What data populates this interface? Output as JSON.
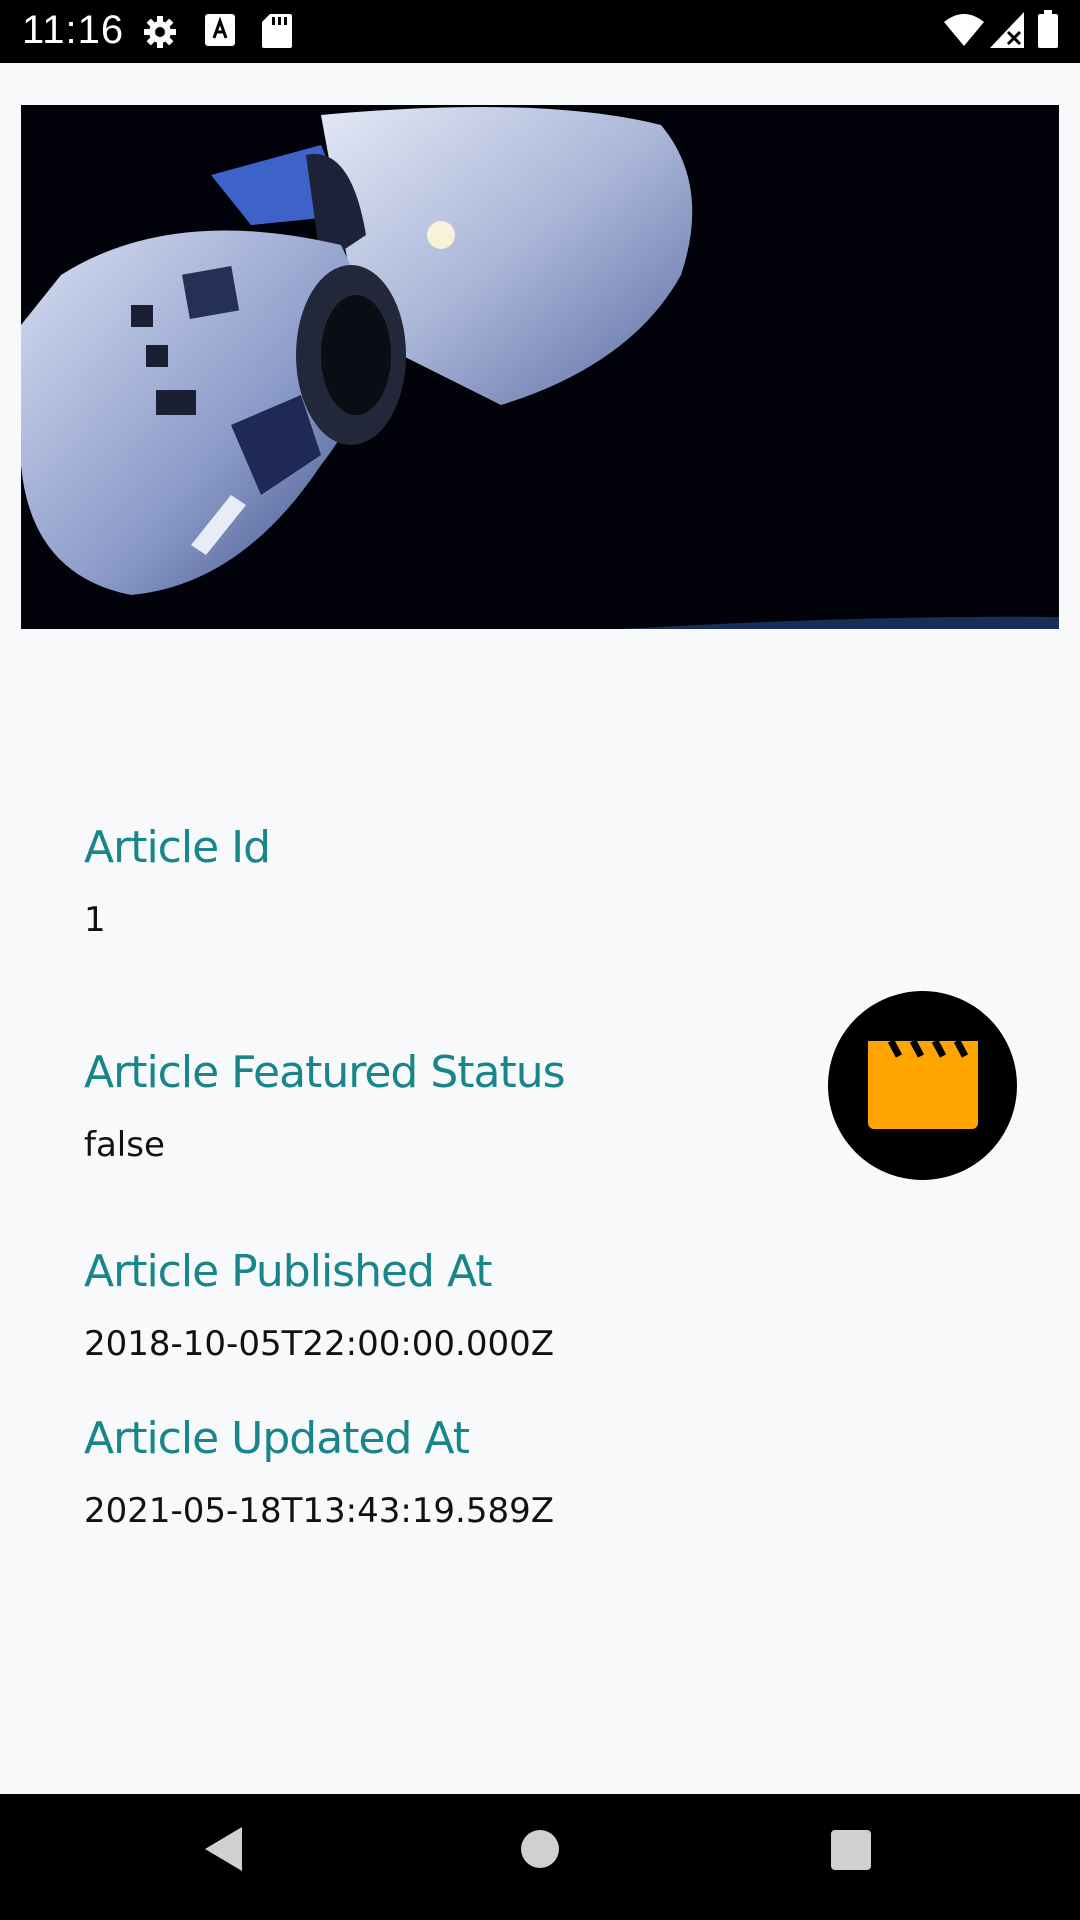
{
  "status_bar": {
    "time": "11:16",
    "icons": [
      "settings-icon",
      "font-download-icon",
      "sd-card-icon",
      "wifi-icon",
      "signal-no-data-icon",
      "battery-icon"
    ]
  },
  "hero": {
    "image": "spacecraft-photo",
    "background": "#02030a"
  },
  "article": {
    "id_label": "Article Id",
    "id_value": "1",
    "featured_label": "Article Featured Status",
    "featured_value": "false",
    "published_label": "Article Published At",
    "published_value": "2018-10-05T22:00:00.000Z",
    "updated_label": "Article Updated At",
    "updated_value": "2021-05-18T13:43:19.589Z"
  },
  "fab": {
    "icon": "movie-clapperboard-icon",
    "icon_color": "#FFA500",
    "background": "#000000"
  },
  "nav_bar": {
    "icons": [
      "back-icon",
      "home-icon",
      "recents-icon"
    ]
  },
  "colors": {
    "label": "#17858A",
    "page_background": "#F8F9FA"
  }
}
